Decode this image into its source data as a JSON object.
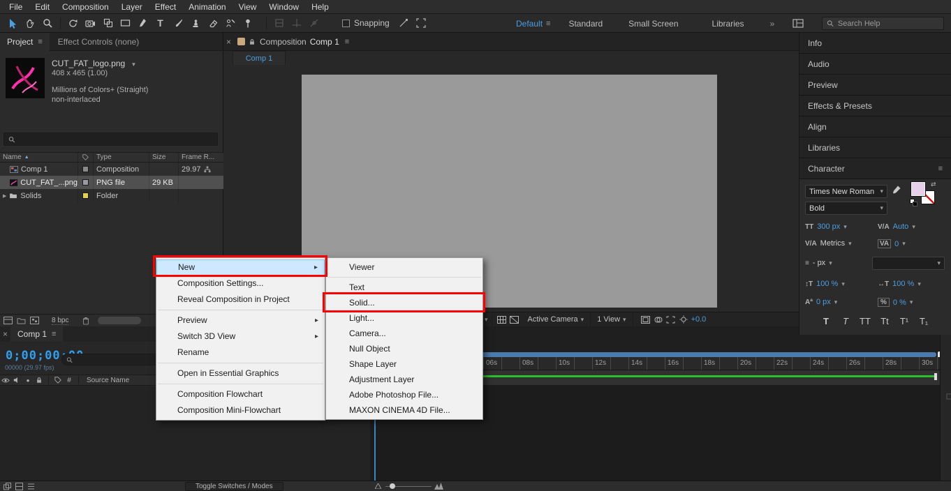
{
  "menubar": {
    "items": [
      "File",
      "Edit",
      "Composition",
      "Layer",
      "Effect",
      "Animation",
      "View",
      "Window",
      "Help"
    ]
  },
  "toolbar": {
    "tools": [
      "selection-tool",
      "hand-tool",
      "zoom-tool",
      "rotation-tool",
      "camera-tool",
      "pan-behind-tool",
      "rectangle-tool",
      "pen-tool",
      "type-tool",
      "brush-tool",
      "clone-stamp-tool",
      "eraser-tool",
      "roto-brush-tool",
      "puppet-pin-tool"
    ],
    "snapping_label": "Snapping",
    "workspaces": [
      "Default",
      "Standard",
      "Small Screen",
      "Libraries"
    ],
    "active_workspace": "Default",
    "overflow": "»",
    "search_placeholder": "Search Help"
  },
  "project": {
    "tabs": [
      "Project",
      "Effect Controls (none)"
    ],
    "preview": {
      "filename": "CUT_FAT_logo.png",
      "dimensions": "408 x 465 (1.00)",
      "line1": "Millions of Colors+ (Straight)",
      "line2": "non-interlaced"
    },
    "columns": {
      "name": "Name",
      "type": "Type",
      "size": "Size",
      "framerate": "Frame R..."
    },
    "rows": [
      {
        "name": "Comp 1",
        "type": "Composition",
        "size": "",
        "framerate": "29.97"
      },
      {
        "name": "CUT_FAT_...png",
        "type": "PNG file",
        "size": "29 KB",
        "framerate": ""
      },
      {
        "name": "Solids",
        "type": "Folder",
        "size": "",
        "framerate": ""
      }
    ],
    "footer": {
      "bpc": "8 bpc"
    }
  },
  "comp": {
    "panel_title": "Composition",
    "comp_name": "Comp 1",
    "tab": "Comp 1",
    "footer": {
      "camera": "Active Camera",
      "view": "1 View",
      "exposure": "+0.0"
    }
  },
  "context_menu": {
    "items": [
      "New",
      "Composition Settings...",
      "Reveal Composition in Project",
      "Preview",
      "Switch 3D View",
      "Rename",
      "Open in Essential Graphics",
      "Composition Flowchart",
      "Composition Mini-Flowchart"
    ]
  },
  "submenu": {
    "items": [
      "Viewer",
      "Text",
      "Solid...",
      "Light...",
      "Camera...",
      "Null Object",
      "Shape Layer",
      "Adjustment Layer",
      "Adobe Photoshop File...",
      "MAXON CINEMA 4D File..."
    ]
  },
  "right_panel": {
    "sections": [
      "Info",
      "Audio",
      "Preview",
      "Effects & Presets",
      "Align",
      "Libraries",
      "Character"
    ],
    "character": {
      "font_family": "Times New Roman",
      "font_style": "Bold",
      "font_size": "300 px",
      "kerning": "Auto",
      "tracking_label": "Metrics",
      "tracking_value": "0",
      "leading": "- px",
      "vertical_scale": "100 %",
      "horizontal_scale": "100 %",
      "baseline_shift": "0 px",
      "tsume": "0 %",
      "icon_glyphs": {
        "size": "TT",
        "kerning": "V/A",
        "tracking": "VA",
        "leading": "≡",
        "vscale": "↕T",
        "hscale": "↔T",
        "baseline": "Aª",
        "tsume": "%"
      },
      "style_buttons": [
        "T",
        "T",
        "TT",
        "Tt",
        "T¹",
        "T₁"
      ]
    }
  },
  "timeline": {
    "tab": "Comp 1",
    "timecode": "0;00;00;00",
    "frame_info": "00000 (29.97 fps)",
    "column_hash": "#",
    "column_source": "Source Name",
    "ruler": [
      "06s",
      "08s",
      "10s",
      "12s",
      "14s",
      "16s",
      "18s",
      "20s",
      "22s",
      "24s",
      "26s",
      "28s",
      "30s"
    ],
    "toggle_button": "Toggle Switches / Modes"
  },
  "icons": {
    "panel_menu": "≡",
    "close": "×",
    "submenu_arrow": "▸",
    "dropdown_chevron": "▾",
    "filename_dropdown": "▼",
    "sort_ascending": "▲",
    "expander": "▶",
    "overflow_chevrons": "»",
    "swap_swatches": "⇄",
    "solo_dot": "●"
  },
  "colors": {
    "accent_blue": "#4b9fe1",
    "timecode_blue": "#2f9fee",
    "annotation_red": "#fe0000",
    "workarea_green": "#2bc02b",
    "fill_swatch": "#e6cfe9",
    "viewport_gray": "#9a9a9a"
  }
}
